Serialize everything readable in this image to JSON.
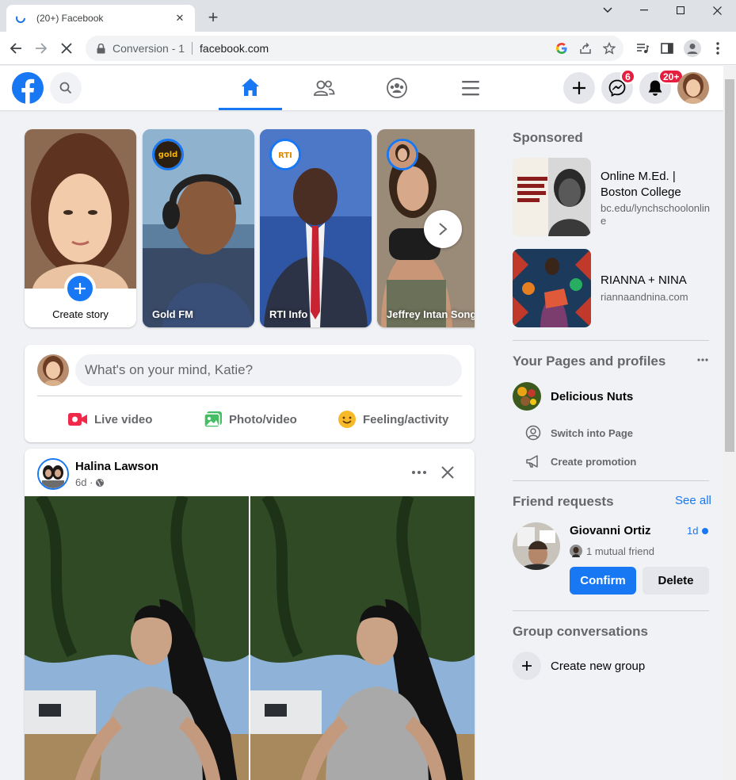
{
  "browser": {
    "tab_title": "(20+) Facebook",
    "tab_close": "✕",
    "new_tab": "+",
    "omnibox_label": "Conversion - 1",
    "url": "facebook.com"
  },
  "header": {
    "messenger_badge": "6",
    "notifications_badge": "20+"
  },
  "stories": {
    "create_label": "Create story",
    "items": [
      {
        "name": "Gold FM"
      },
      {
        "name": "RTI Info"
      },
      {
        "name": "Jeffrey Intan Songs"
      }
    ]
  },
  "composer": {
    "placeholder": "What's on your mind, Katie?",
    "actions": [
      {
        "label": "Live video"
      },
      {
        "label": "Photo/video"
      },
      {
        "label": "Feeling/activity"
      }
    ]
  },
  "post": {
    "author": "Halina Lawson",
    "time": "6d ·"
  },
  "sidebar": {
    "sponsored_heading": "Sponsored",
    "ads": [
      {
        "title": "Online M.Ed. | Boston College",
        "url": "bc.edu/lynchschoolonline"
      },
      {
        "title": "RIANNA + NINA",
        "url": "riannaandnina.com"
      }
    ],
    "pages_heading": "Your Pages and profiles",
    "page_name": "Delicious Nuts",
    "switch_label": "Switch into Page",
    "promo_label": "Create promotion",
    "friend_requests_heading": "Friend requests",
    "see_all": "See all",
    "request": {
      "name": "Giovanni Ortiz",
      "time": "1d",
      "mutual": "1 mutual friend",
      "confirm": "Confirm",
      "delete": "Delete"
    },
    "group_heading": "Group conversations",
    "create_group": "Create new group"
  },
  "colors": {
    "brand": "#1877f2",
    "badge": "#e41e3f",
    "background": "#f0f2f5"
  }
}
